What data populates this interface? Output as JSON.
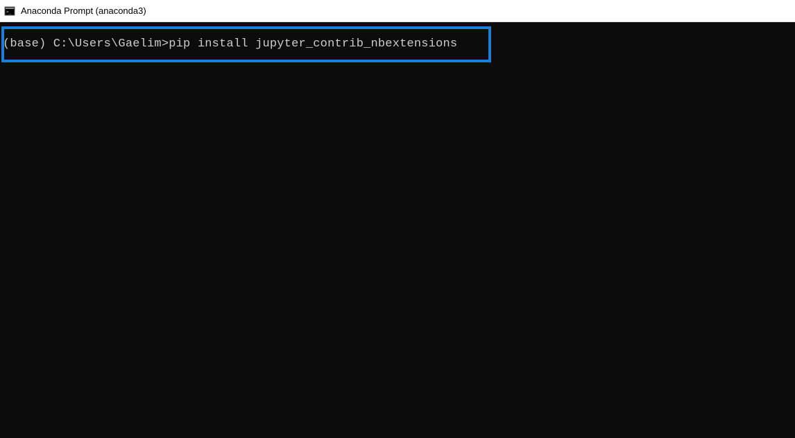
{
  "titlebar": {
    "title": "Anaconda Prompt (anaconda3)"
  },
  "terminal": {
    "prompt": "(base) C:\\Users\\Gaelim>",
    "command": "pip install jupyter_contrib_nbextensions"
  },
  "highlight": {
    "color": "#1b7fd9"
  }
}
